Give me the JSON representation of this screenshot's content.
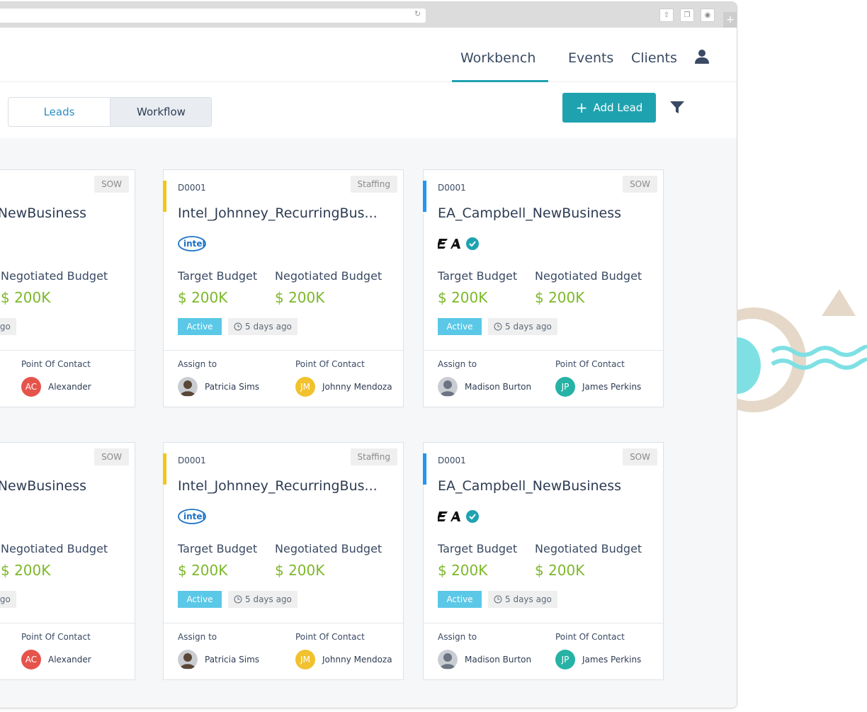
{
  "nav": {
    "workbench": "Workbench",
    "events": "Events",
    "clients": "Clients"
  },
  "toolbar": {
    "leads": "Leads",
    "workflow": "Workflow",
    "add_lead": "Add Lead"
  },
  "colors": {
    "accent": "#1fa2b0",
    "money": "#7cb829",
    "status": "#5ac8e6",
    "accent_staffing": "#f5c518",
    "accent_sow": "#2196f3"
  },
  "cards": [
    {
      "code": "",
      "tag": "SOW",
      "title": "l_NewBusiness",
      "logo": "",
      "target_label": "",
      "negotiated_label": "Negotiated  Budget",
      "target_value": "",
      "negotiated_value": "$ 200K",
      "status": "",
      "ago": "ays ago",
      "assign_label": "",
      "contact_label": "Point Of Contact",
      "assignee": "",
      "contact": "Alexander",
      "contact_initials": "AC"
    },
    {
      "code": "D0001",
      "tag": "Staffing",
      "title": "Intel_Johnney_RecurringBus...",
      "logo": "intel",
      "target_label": "Target Budget",
      "negotiated_label": "Negotiated  Budget",
      "target_value": "$ 200K",
      "negotiated_value": "$ 200K",
      "status": "Active",
      "ago": "5 days ago",
      "assign_label": "Assign to",
      "contact_label": "Point Of Contact",
      "assignee": "Patricia Sims",
      "contact": "Johnny Mendoza",
      "contact_initials": "JM"
    },
    {
      "code": "D0001",
      "tag": "SOW",
      "title": "EA_Campbell_NewBusiness",
      "logo": "ea",
      "target_label": "Target Budget",
      "negotiated_label": "Negotiated  Budget",
      "target_value": "$ 200K",
      "negotiated_value": "$ 200K",
      "status": "Active",
      "ago": "5 days ago",
      "assign_label": "Assign to",
      "contact_label": "Point Of Contact",
      "assignee": "Madison Burton",
      "contact": "James Perkins",
      "contact_initials": "JP"
    },
    {
      "code": "",
      "tag": "SOW",
      "title": "l_NewBusiness",
      "logo": "",
      "target_label": "",
      "negotiated_label": "Negotiated  Budget",
      "target_value": "",
      "negotiated_value": "$ 200K",
      "status": "",
      "ago": "ays ago",
      "assign_label": "",
      "contact_label": "Point Of Contact",
      "assignee": "",
      "contact": "Alexander",
      "contact_initials": "AC"
    },
    {
      "code": "D0001",
      "tag": "Staffing",
      "title": "Intel_Johnney_RecurringBus...",
      "logo": "intel",
      "target_label": "Target Budget",
      "negotiated_label": "Negotiated  Budget",
      "target_value": "$ 200K",
      "negotiated_value": "$ 200K",
      "status": "Active",
      "ago": "5 days ago",
      "assign_label": "Assign to",
      "contact_label": "Point Of Contact",
      "assignee": "Patricia Sims",
      "contact": "Johnny Mendoza",
      "contact_initials": "JM"
    },
    {
      "code": "D0001",
      "tag": "SOW",
      "title": "EA_Campbell_NewBusiness",
      "logo": "ea",
      "target_label": "Target Budget",
      "negotiated_label": "Negotiated  Budget",
      "target_value": "$ 200K",
      "negotiated_value": "$ 200K",
      "status": "Active",
      "ago": "5 days ago",
      "assign_label": "Assign to",
      "contact_label": "Point Of Contact",
      "assignee": "Madison Burton",
      "contact": "James Perkins",
      "contact_initials": "JP"
    }
  ]
}
